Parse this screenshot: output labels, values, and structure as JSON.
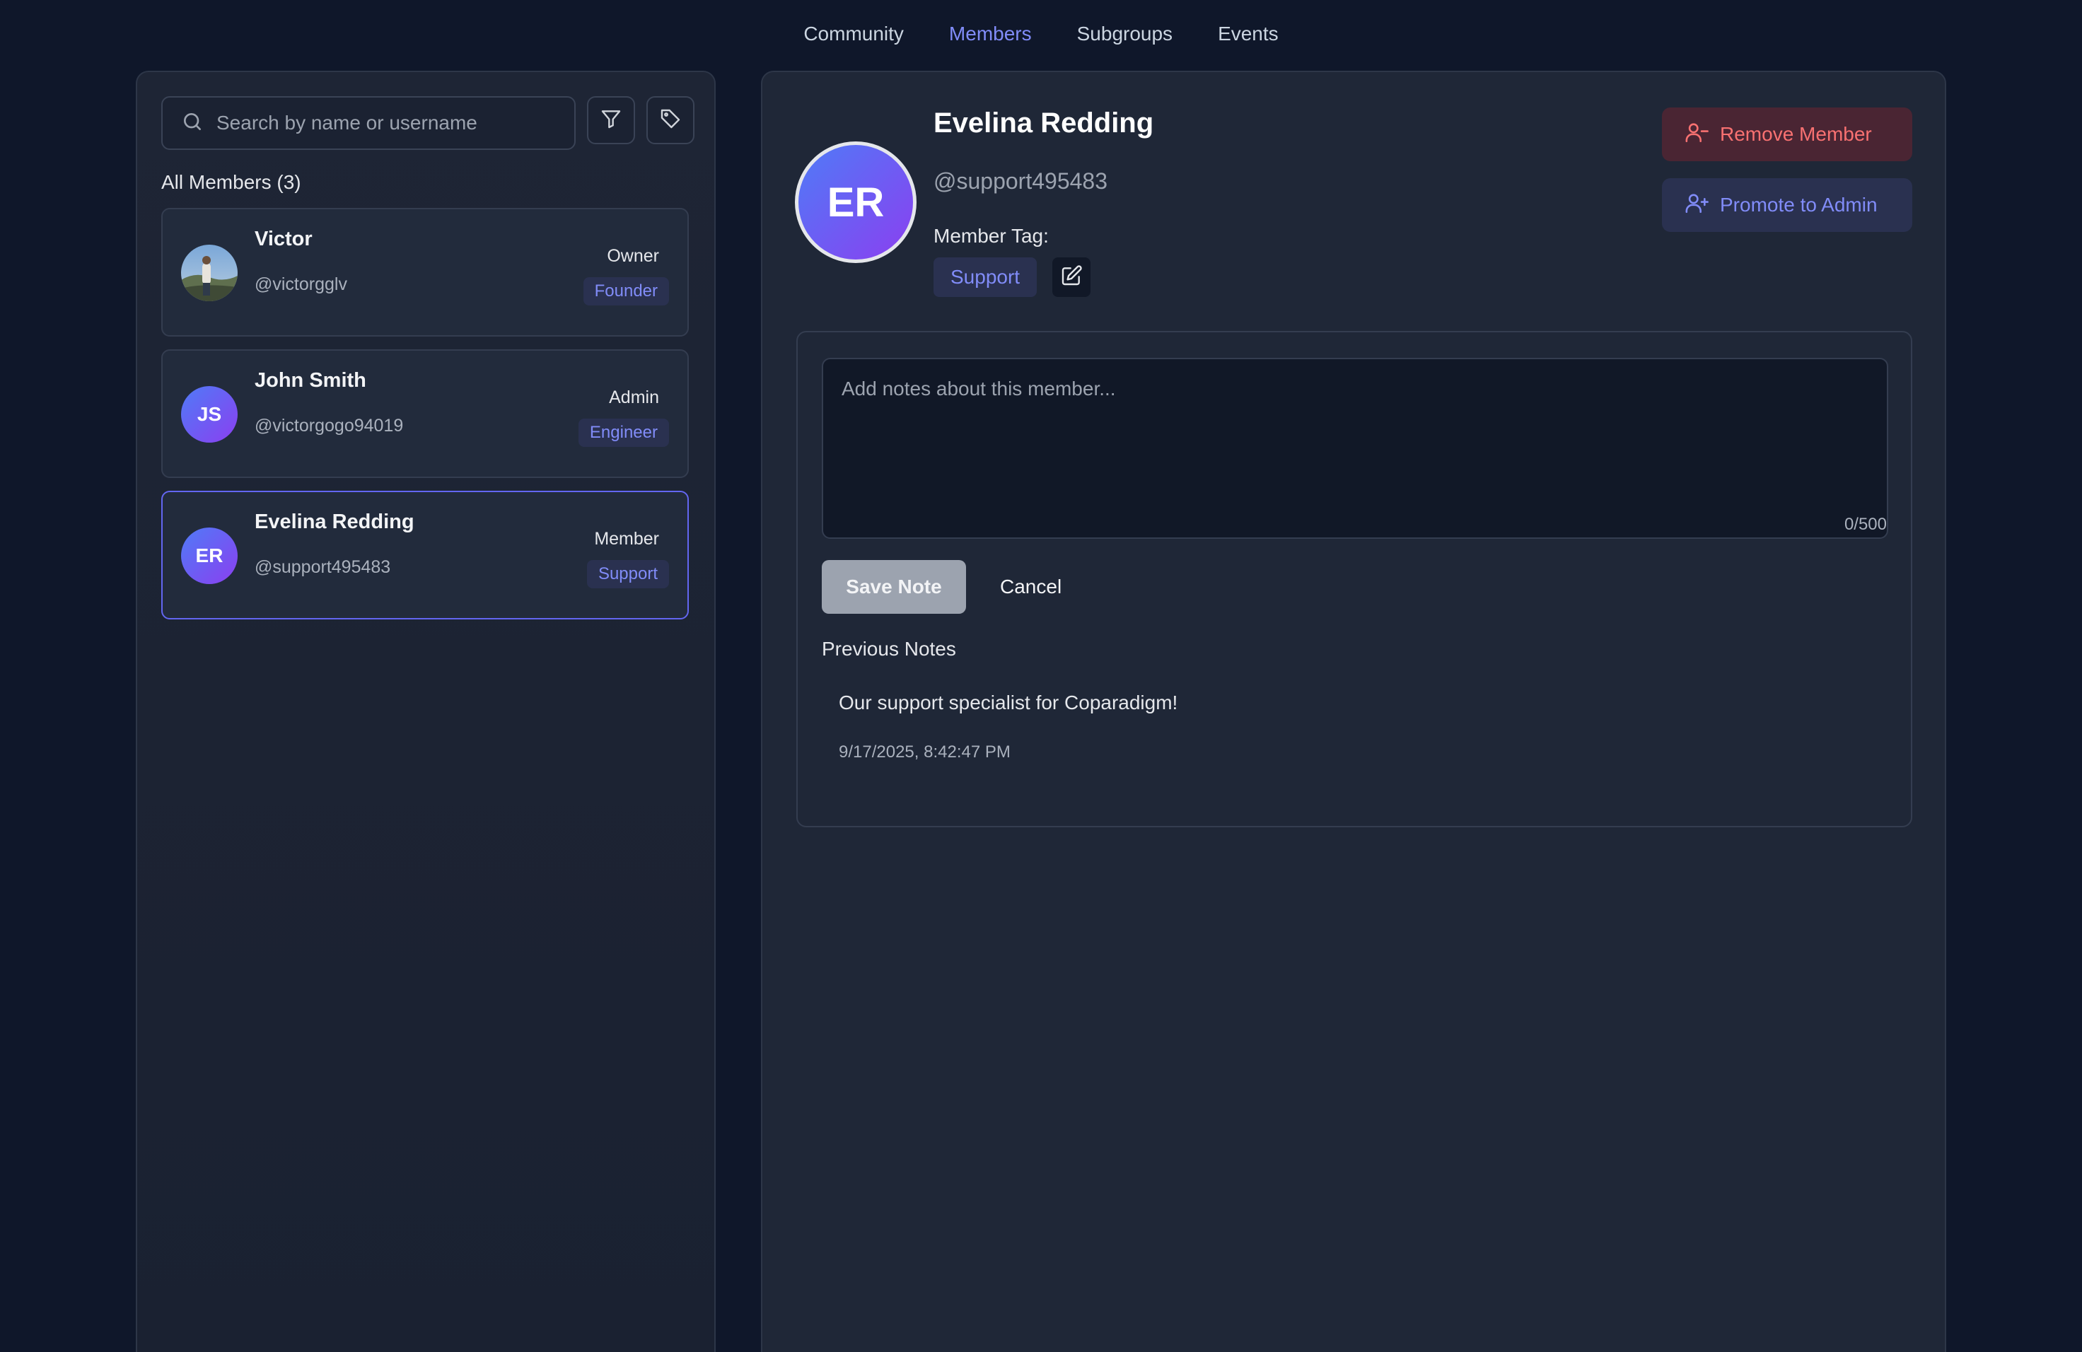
{
  "nav": {
    "tabs": [
      {
        "label": "Community"
      },
      {
        "label": "Members"
      },
      {
        "label": "Subgroups"
      },
      {
        "label": "Events"
      }
    ],
    "active": "Members"
  },
  "left": {
    "search": {
      "placeholder": "Search by name or username",
      "value": ""
    },
    "filter_icon": "filter-icon",
    "tag_icon": "tag-icon",
    "all_members_label": "All Members (3)",
    "members": [
      {
        "name": "Victor",
        "username": "@victorgglv",
        "role": "Owner",
        "tag": "Founder",
        "initials": ""
      },
      {
        "name": "John Smith",
        "username": "@victorgogo94019",
        "role": "Admin",
        "tag": "Engineer",
        "initials": "JS"
      },
      {
        "name": "Evelina Redding",
        "username": "@support495483",
        "role": "Member",
        "tag": "Support",
        "initials": "ER"
      }
    ]
  },
  "profile": {
    "initials": "ER",
    "name": "Evelina Redding",
    "username": "@support495483",
    "tag_label": "Member Tag:",
    "tag": "Support",
    "remove_label": "Remove Member",
    "promote_label": "Promote to Admin"
  },
  "notes": {
    "placeholder": "Add notes about this member...",
    "value": "",
    "char_count": "0/500",
    "save_label": "Save Note",
    "cancel_label": "Cancel",
    "previous_title": "Previous Notes",
    "previous": [
      {
        "text": "Our support specialist for Coparadigm!",
        "time": "9/17/2025, 8:42:47 PM"
      }
    ]
  },
  "colors": {
    "background": "#0f172a",
    "accent": "#818cf8",
    "danger": "#f87171"
  }
}
